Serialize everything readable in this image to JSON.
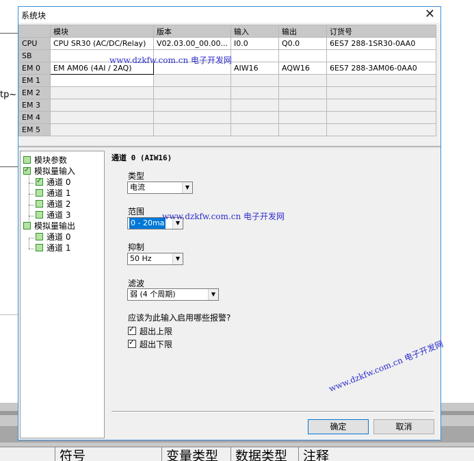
{
  "dialog": {
    "title": "系统块"
  },
  "background": {
    "fragment": "tp~",
    "columns": [
      "符号",
      "变量类型",
      "数据类型",
      "注释"
    ]
  },
  "grid": {
    "headers": [
      "",
      "模块",
      "版本",
      "输入",
      "输出",
      "订货号"
    ],
    "rows": [
      {
        "slot": "CPU",
        "module": "CPU SR30 (AC/DC/Relay)",
        "version": "V02.03.00_00.00...",
        "input": "I0.0",
        "output": "Q0.0",
        "order": "6ES7 288-1SR30-0AA0"
      },
      {
        "slot": "SB",
        "module": "",
        "version": "",
        "input": "",
        "output": "",
        "order": ""
      },
      {
        "slot": "EM 0",
        "module": "EM AM06 (4AI / 2AQ)",
        "version": "",
        "input": "AIW16",
        "output": "AQW16",
        "order": "6ES7 288-3AM06-0AA0"
      },
      {
        "slot": "EM 1",
        "module": "",
        "version": "",
        "input": "",
        "output": "",
        "order": ""
      },
      {
        "slot": "EM 2",
        "module": "",
        "version": "",
        "input": "",
        "output": "",
        "order": ""
      },
      {
        "slot": "EM 3",
        "module": "",
        "version": "",
        "input": "",
        "output": "",
        "order": ""
      },
      {
        "slot": "EM 4",
        "module": "",
        "version": "",
        "input": "",
        "output": "",
        "order": ""
      },
      {
        "slot": "EM 5",
        "module": "",
        "version": "",
        "input": "",
        "output": "",
        "order": ""
      }
    ]
  },
  "tree": {
    "module_params": "模块参数",
    "analog_input": "模拟量输入",
    "ai_channels": [
      "通道 0",
      "通道 1",
      "通道 2",
      "通道 3"
    ],
    "analog_output": "模拟量输出",
    "aq_channels": [
      "通道 0",
      "通道 1"
    ]
  },
  "panel": {
    "title": "通道 0 (AIW16)",
    "type_label": "类型",
    "type_value": "电流",
    "range_label": "范围",
    "range_value": "0 - 20ma",
    "rejection_label": "抑制",
    "rejection_value": "50 Hz",
    "filter_label": "滤波",
    "filter_value": "弱 (4 个周期)",
    "alarm_question": "应该为此输入启用哪些报警?",
    "alarm_high": "超出上限",
    "alarm_low": "超出下限"
  },
  "buttons": {
    "ok": "确定",
    "cancel": "取消"
  },
  "watermark": "www.dzkfw.com.cn 电子开发网"
}
